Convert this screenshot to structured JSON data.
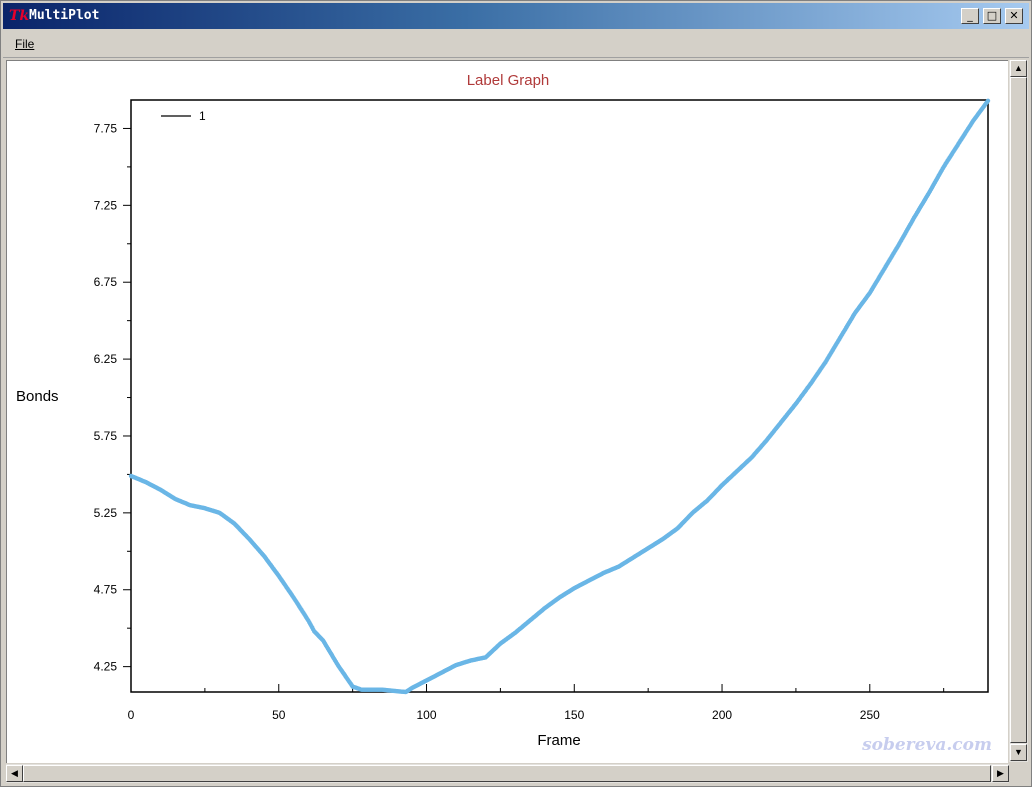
{
  "window": {
    "title": "MultiPlot",
    "icon": "tk-icon",
    "icon_text": "Tk",
    "buttons": {
      "minimize": "minimize-icon",
      "maximize": "maximize-icon",
      "close": "close-icon"
    }
  },
  "menubar": {
    "file": "File"
  },
  "plot": {
    "watermark": "sobereva.com"
  },
  "chart_data": {
    "type": "scatter",
    "title": "Label Graph",
    "xlabel": "Frame",
    "ylabel": "Bonds",
    "xlim": [
      0,
      290
    ],
    "ylim": [
      4.085,
      7.935
    ],
    "x_ticks": [
      0,
      50,
      100,
      150,
      200,
      250
    ],
    "y_ticks": [
      4.25,
      4.75,
      5.25,
      5.75,
      6.25,
      6.75,
      7.25,
      7.75
    ],
    "legend": {
      "position": "top-left"
    },
    "colors": {
      "title": "#b03a3a",
      "points": "#6ab6e6",
      "line": "#000000"
    },
    "grid": false,
    "series": [
      {
        "name": "1",
        "x": [
          0,
          5,
          10,
          15,
          20,
          25,
          30,
          35,
          40,
          45,
          50,
          55,
          60,
          62,
          65,
          70,
          75,
          78,
          80,
          85,
          90,
          93,
          95,
          100,
          105,
          110,
          115,
          120,
          125,
          130,
          135,
          140,
          145,
          150,
          155,
          160,
          165,
          170,
          175,
          180,
          185,
          190,
          195,
          200,
          205,
          210,
          215,
          220,
          225,
          230,
          235,
          240,
          245,
          250,
          255,
          260,
          265,
          270,
          275,
          280,
          285,
          290
        ],
        "y": [
          5.49,
          5.45,
          5.4,
          5.34,
          5.3,
          5.28,
          5.25,
          5.18,
          5.08,
          4.97,
          4.84,
          4.7,
          4.55,
          4.48,
          4.42,
          4.26,
          4.12,
          4.1,
          4.1,
          4.1,
          4.09,
          4.085,
          4.11,
          4.16,
          4.21,
          4.26,
          4.29,
          4.31,
          4.4,
          4.47,
          4.55,
          4.63,
          4.7,
          4.76,
          4.81,
          4.86,
          4.9,
          4.96,
          5.02,
          5.08,
          5.15,
          5.25,
          5.33,
          5.43,
          5.52,
          5.61,
          5.72,
          5.84,
          5.96,
          6.09,
          6.23,
          6.39,
          6.55,
          6.68,
          6.84,
          7.0,
          7.17,
          7.33,
          7.5,
          7.65,
          7.8,
          7.93
        ]
      }
    ]
  }
}
